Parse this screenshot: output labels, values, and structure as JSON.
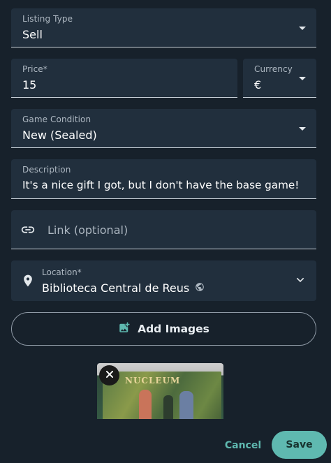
{
  "form": {
    "listing_type": {
      "label": "Listing Type",
      "value": "Sell"
    },
    "price": {
      "label": "Price*",
      "value": "15"
    },
    "currency": {
      "label": "Currency",
      "value": "€"
    },
    "condition": {
      "label": "Game Condition",
      "value": "New (Sealed)"
    },
    "description": {
      "label": "Description",
      "value": "It's a nice gift I got, but I don't have the base game!"
    },
    "link": {
      "placeholder": "Link (optional)",
      "icon": "link-icon"
    },
    "location": {
      "label": "Location*",
      "value": "Biblioteca Central de Reus",
      "icon": "location-pin-icon",
      "badge_icon": "globe-icon"
    },
    "add_images_label": "Add Images",
    "image_preview": {
      "caption": "NUCLEUM",
      "remove_icon": "close-icon"
    }
  },
  "actions": {
    "cancel_label": "Cancel",
    "save_label": "Save"
  },
  "colors": {
    "background": "#17212b",
    "field": "#212f3d",
    "accent": "#5fb9b0"
  }
}
